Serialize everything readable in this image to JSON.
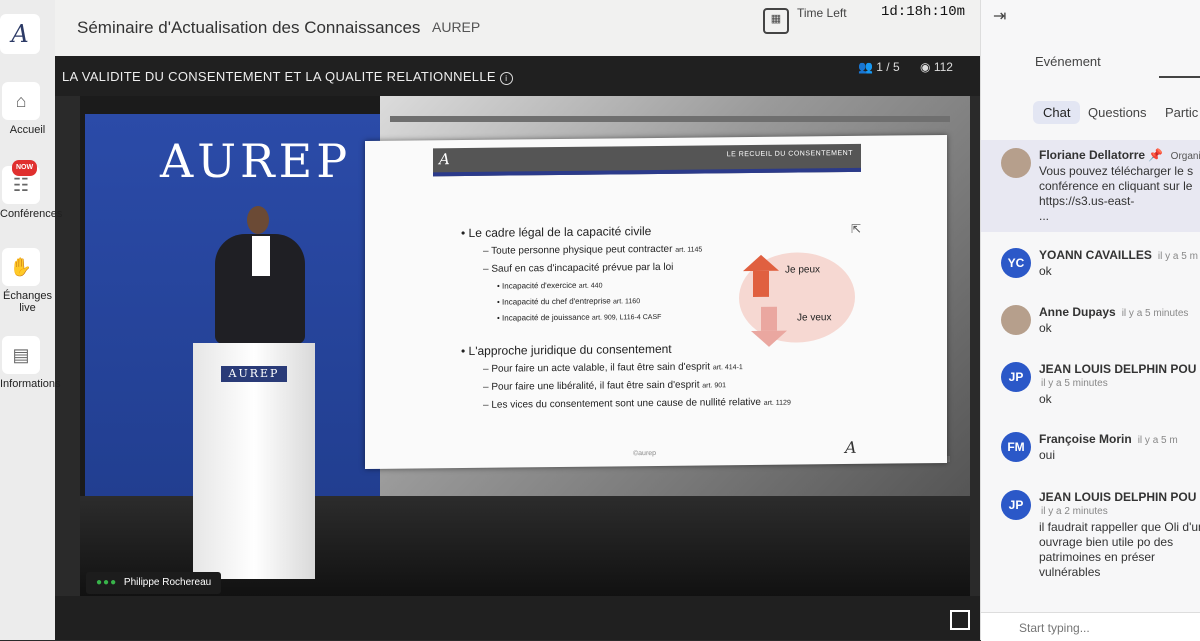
{
  "sidebar": {
    "logo": "A",
    "items": [
      {
        "label": "Accueil",
        "icon": "home-icon"
      },
      {
        "label": "Conférences",
        "icon": "conference-icon",
        "badge": "NOW"
      },
      {
        "label": "Échanges live",
        "icon": "handshake-icon"
      },
      {
        "label": "Informations",
        "icon": "kiosk-icon"
      }
    ]
  },
  "topbar": {
    "event_title": "Séminaire d'Actualisation des Connaissances",
    "org": "AUREP",
    "time_left_label": "Time Left",
    "countdown": "1d:18h:10m"
  },
  "session": {
    "title": "LA VALIDITE DU CONSENTEMENT ET LA QUALITE RELATIONNELLE",
    "participants": "1 / 5",
    "viewers": "112"
  },
  "stage": {
    "wall_logo": "AUREP",
    "podium_logo": "AUREP",
    "speaker_name": "Philippe Rochereau",
    "slide": {
      "header_logo": "A",
      "header_title": "LE RECUEIL DU CONSENTEMENT",
      "section1": "Le cadre légal de la capacité civile",
      "s1_item1": "Toute personne physique peut contracter",
      "s1_item1_art": "art. 1145",
      "s1_item2": "Sauf en cas d'incapacité prévue par la loi",
      "s1_sub1": "Incapacité d'exercice",
      "s1_sub1_art": "art. 440",
      "s1_sub2": "Incapacité du chef d'entreprise",
      "s1_sub2_art": "art. 1160",
      "s1_sub3": "Incapacité de jouissance",
      "s1_sub3_art": "art. 909, L116-4 CASF",
      "section2": "L'approche juridique du consentement",
      "s2_item1": "Pour faire un acte valable, il faut être sain d'esprit",
      "s2_item1_art": "art. 414-1",
      "s2_item2": "Pour faire une libéralité, il faut être sain d'esprit",
      "s2_item2_art": "art. 901",
      "s2_item3": "Les vices du consentement sont une cause de nullité relative",
      "s2_item3_art": "art. 1129",
      "je_peux": "Je peux",
      "je_veux": "Je veux",
      "copyright": "©aurep",
      "footer_logo": "A"
    }
  },
  "panel": {
    "title": "Evénement",
    "tabs": [
      "Chat",
      "Questions",
      "Partic"
    ],
    "pinned": {
      "name": "Floriane Dellatorre",
      "role": "Organi",
      "text": "Vous pouvez télécharger le s conférence en cliquant sur le https://s3.us-east-",
      "more": "..."
    },
    "messages": [
      {
        "initials": "YC",
        "name": "YOANN CAVAILLES",
        "time": "il y a 5 m",
        "text": "ok"
      },
      {
        "initials": "",
        "name": "Anne Dupays",
        "time": "il y a 5 minutes",
        "text": "ok"
      },
      {
        "initials": "JP",
        "name": "JEAN LOUIS DELPHIN POU",
        "time": "il y a 5 minutes",
        "text": "ok"
      },
      {
        "initials": "FM",
        "name": "Françoise Morin",
        "time": "il y a 5 m",
        "text": "oui"
      },
      {
        "initials": "JP",
        "name": "JEAN LOUIS DELPHIN POU",
        "time": "il y a 2 minutes",
        "text": "il faudrait rappeller que Oli d'un ouvrage bien utile po des patrimoines en préser vulnérables"
      }
    ],
    "composer_placeholder": "Start typing..."
  }
}
